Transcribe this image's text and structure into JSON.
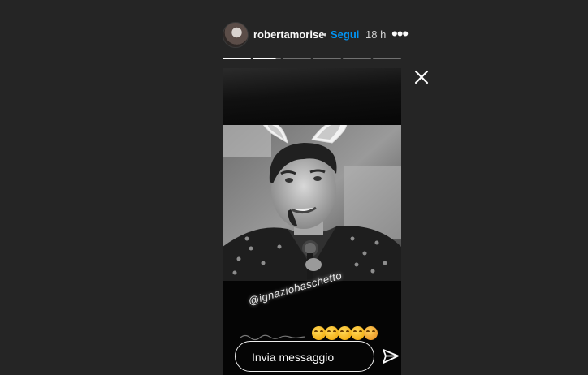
{
  "header": {
    "username": "robertamorise",
    "separator": "•",
    "follow_label": "Segui",
    "time": "18 h",
    "more_label": "•••"
  },
  "progress": {
    "segments": 6,
    "completed": 1,
    "current_fraction": 0.82
  },
  "story": {
    "mention": "@ignaziobaschetto",
    "emojis": [
      "😂",
      "😂",
      "😂",
      "😂",
      "🥰"
    ]
  },
  "reply": {
    "placeholder": "Invia messaggio"
  },
  "icons": {
    "avatar": "profile-avatar",
    "more": "more-options-icon",
    "close": "close-icon",
    "send": "send-paper-plane-icon"
  },
  "colors": {
    "background": "#252525",
    "follow": "#0095f6",
    "text": "#fafafa"
  }
}
